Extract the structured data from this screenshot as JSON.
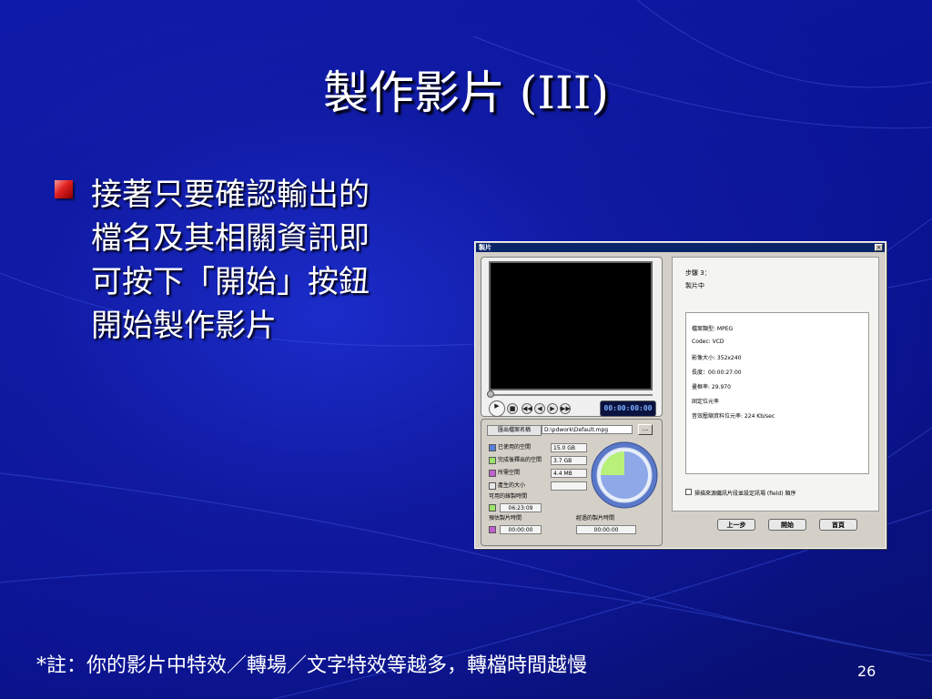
{
  "slide": {
    "title": "製作影片 (III)",
    "bullet_lines": [
      "接著只要確認輸出的",
      "檔名及其相關資訊即",
      "可按下「開始」按鈕",
      "開始製作影片"
    ],
    "footnote": "*註：你的影片中特效／轉場／文字特效等越多，轉檔時間越慢",
    "page_number": "26"
  },
  "dialog": {
    "title": "製片",
    "close_glyph": "×",
    "preview": {
      "timecode": "00:00:00:00",
      "controls": [
        "play-icon",
        "stop-icon",
        "rewind-icon",
        "prev-icon",
        "next-icon",
        "end-icon"
      ],
      "play_glyph": "▶",
      "stop_glyph": "■",
      "rew_glyph": "◀◀",
      "prev_glyph": "◀",
      "next_glyph": "▶",
      "end_glyph": "▶▶"
    },
    "output": {
      "label": "匯出檔案名稱",
      "value": "D:\\pdwork\\Default.mpg",
      "browse_label": "..."
    },
    "stats": {
      "used_label": "已使用的空間",
      "used_value": "15.0 GB",
      "used_color": "#5a7fd8",
      "after_label": "完成後釋出的空間",
      "after_value": "3.7 GB",
      "after_color": "#9be36a",
      "need_label": "所需空間",
      "need_value": "4.4 MB",
      "need_color": "#c060d0",
      "gen_label": "產生的大小",
      "gen_value": "",
      "gen_color": "#e8e8e8",
      "avail_time_label": "可用的錄製時間",
      "avail_time_value": "06:23:09",
      "avail_time_color": "#9be36a",
      "est_time_label": "預估製片時間",
      "est_time_value": "00:00:00",
      "est_time_color": "#c060d0",
      "elapsed_label": "經過的製片時間",
      "elapsed_value": "00:00:00"
    },
    "gauge": {
      "used_fraction": 0.75,
      "free_fraction": 0.25,
      "used_color": "#8fa8e8",
      "free_color": "#b8f07a"
    },
    "right": {
      "step": "步驟 3：",
      "status": "製片中",
      "info": [
        "檔案類型: MPEG",
        "Codec: VCD",
        "影像大小: 352x240",
        "長度：00:00:27:00",
        "畫框率: 29.970",
        "固定位元率",
        "音效壓縮資料位元率: 224 Kb/sec"
      ],
      "checkbox_label": "掃描來源纖訊片段並設定訊場 (field) 順序",
      "buttons": {
        "back": "上一步",
        "start": "開始",
        "home": "首頁"
      }
    }
  }
}
